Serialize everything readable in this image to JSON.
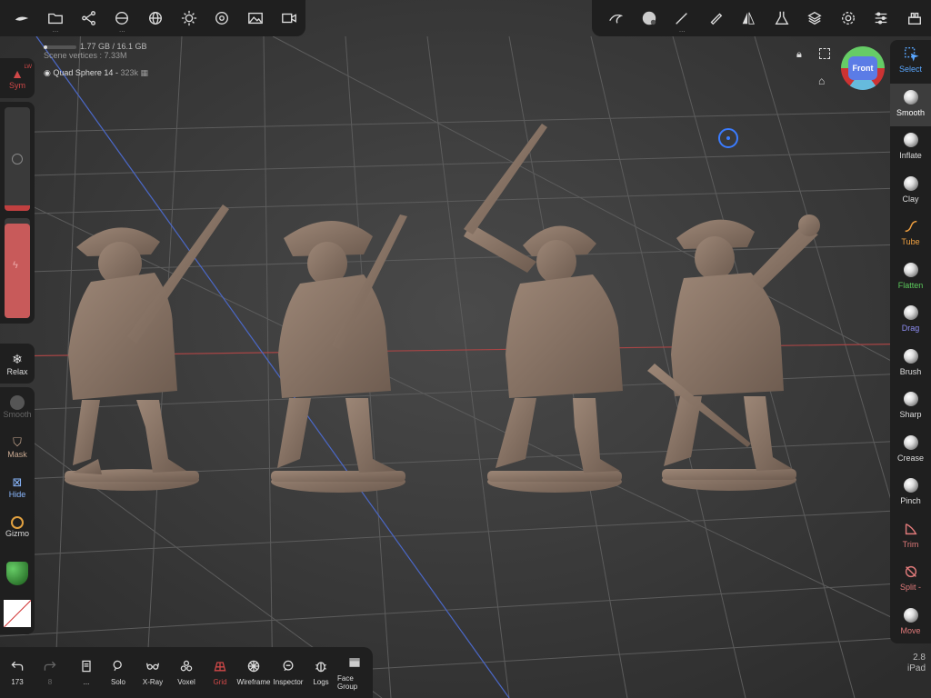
{
  "stats": {
    "memory": "1.77 GB / 16.1 GB",
    "memory_fraction": 0.11,
    "scene_vertices": "Scene vertices : 7.33M"
  },
  "mesh": {
    "name": "Quad Sphere 14",
    "polycount": "323k"
  },
  "top_left_tools": [
    "logo-icon",
    "folder-icon",
    "scene-graph-icon",
    "camera-icon",
    "globe-icon",
    "light-icon",
    "material-icon",
    "background-icon",
    "video-icon"
  ],
  "top_right_tools": [
    "stroke-icon",
    "brush-preview-icon",
    "painting-icon",
    "eraser-icon",
    "symmetry-icon",
    "flask-icon",
    "layers-icon",
    "settings-icon",
    "sliders-icon",
    "multires-icon"
  ],
  "left": {
    "sym": "Sym",
    "sym_badge": "LW",
    "relax": "Relax",
    "smooth": "Smooth",
    "mask": "Mask",
    "hide": "Hide",
    "gizmo": "Gizmo",
    "radius_level": 0.05,
    "intensity_level": 0.95
  },
  "right_tools": [
    {
      "label": "Select",
      "color": "#5aa7ff"
    },
    {
      "label": "Smooth",
      "color": "#ffffff"
    },
    {
      "label": "Inflate",
      "color": "#dddddd"
    },
    {
      "label": "Clay",
      "color": "#dddddd"
    },
    {
      "label": "Tube",
      "color": "#f0a040"
    },
    {
      "label": "Flatten",
      "color": "#5ccb5c"
    },
    {
      "label": "Drag",
      "color": "#8d8df2"
    },
    {
      "label": "Brush",
      "color": "#dddddd"
    },
    {
      "label": "Sharp",
      "color": "#dddddd"
    },
    {
      "label": "Crease",
      "color": "#dddddd"
    },
    {
      "label": "Pinch",
      "color": "#dddddd"
    },
    {
      "label": "Trim",
      "color": "#e07a7a"
    },
    {
      "label": "Split -",
      "color": "#e07a7a"
    },
    {
      "label": "Move",
      "color": "#e07a7a"
    }
  ],
  "gizmo_view": "Front",
  "bottom": {
    "undo_count": "173",
    "redo_count": "8",
    "more": "...",
    "solo": "Solo",
    "xray": "X-Ray",
    "voxel": "Voxel",
    "grid": "Grid",
    "wireframe": "Wireframe",
    "inspector": "Inspector",
    "logs": "Logs",
    "facegroup": "Face Group"
  },
  "version": {
    "number": "2.8",
    "device": "iPad"
  },
  "colors": {
    "accent_red": "#c0393b",
    "grid_red": "#b04040",
    "grid_blue": "#4060c0",
    "model": "#8a7565"
  }
}
